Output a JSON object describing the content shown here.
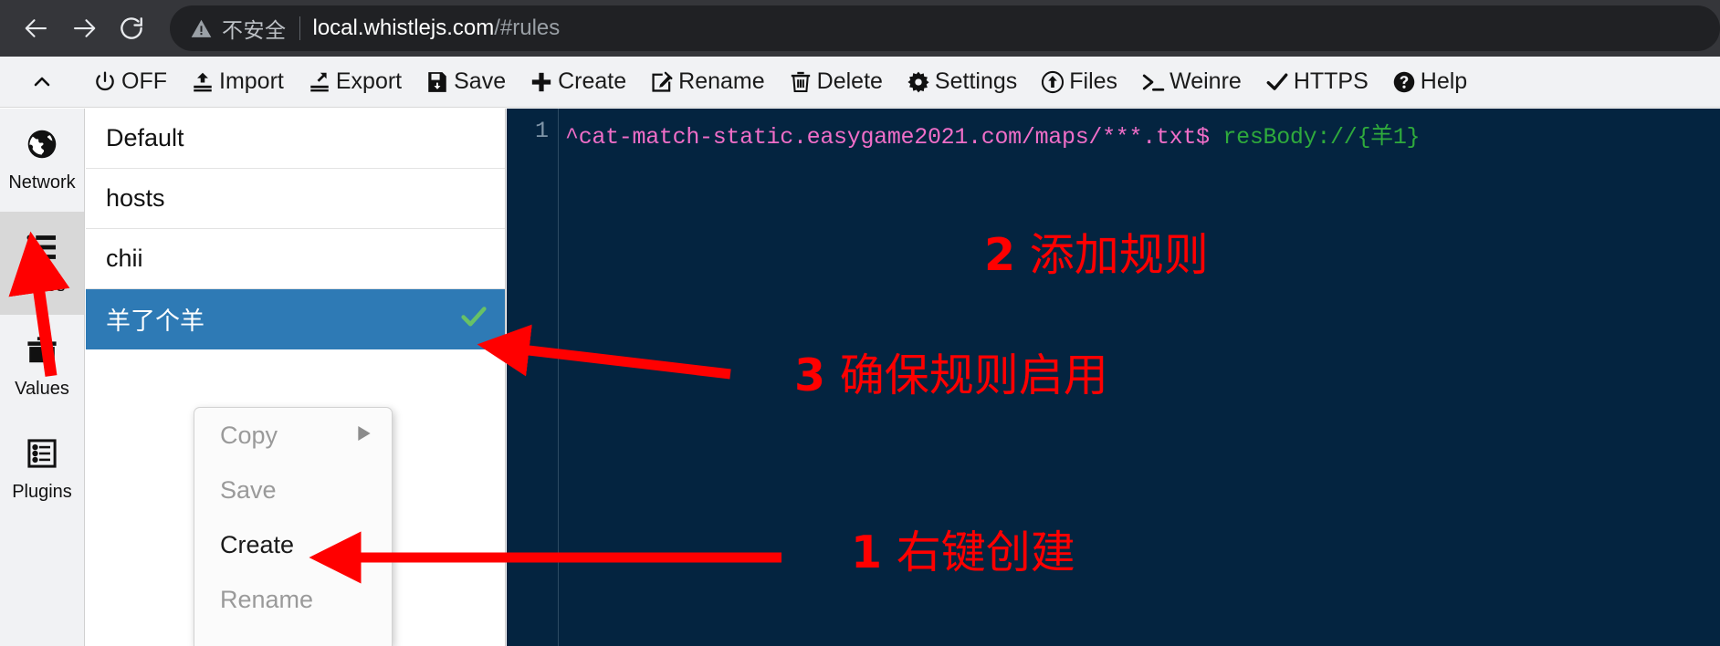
{
  "browser": {
    "back_icon": "arrow-left-icon",
    "forward_icon": "arrow-right-icon",
    "reload_icon": "reload-icon",
    "security_icon": "warning-triangle-icon",
    "security_label": "不安全",
    "url_host": "local.whistlejs.com",
    "url_path": "/#rules"
  },
  "toolbar": {
    "collapse_icon": "chevron-up-icon",
    "items": [
      {
        "label": "OFF",
        "icon": "power-icon"
      },
      {
        "label": "Import",
        "icon": "import-icon"
      },
      {
        "label": "Export",
        "icon": "export-icon"
      },
      {
        "label": "Save",
        "icon": "save-disk-icon"
      },
      {
        "label": "Create",
        "icon": "plus-icon"
      },
      {
        "label": "Rename",
        "icon": "pencil-square-icon"
      },
      {
        "label": "Delete",
        "icon": "trash-icon"
      },
      {
        "label": "Settings",
        "icon": "gear-icon"
      },
      {
        "label": "Files",
        "icon": "upload-circle-icon"
      },
      {
        "label": "Weinre",
        "icon": "terminal-prompt-icon"
      },
      {
        "label": "HTTPS",
        "icon": "check-icon"
      },
      {
        "label": "Help",
        "icon": "question-circle-icon"
      }
    ]
  },
  "rail": {
    "items": [
      {
        "label": "Network",
        "icon": "globe-icon",
        "active": false
      },
      {
        "label": "Rules",
        "icon": "list-icon",
        "active": true
      },
      {
        "label": "Values",
        "icon": "briefcase-icon",
        "active": false
      },
      {
        "label": "Plugins",
        "icon": "list-box-icon",
        "active": false
      }
    ]
  },
  "rules_list": {
    "rows": [
      {
        "name": "Default",
        "selected": false,
        "enabled": false
      },
      {
        "name": "hosts",
        "selected": false,
        "enabled": false
      },
      {
        "name": "chii",
        "selected": false,
        "enabled": false
      },
      {
        "name": "羊了个羊",
        "selected": true,
        "enabled": true,
        "check_icon": "check-icon"
      }
    ]
  },
  "context_menu": {
    "items": [
      {
        "label": "Copy",
        "enabled": false,
        "submenu_icon": "caret-right-icon",
        "has_submenu": true
      },
      {
        "label": "Save",
        "enabled": false,
        "has_submenu": false
      },
      {
        "label": "Create",
        "enabled": true,
        "has_submenu": false
      },
      {
        "label": "Rename",
        "enabled": false,
        "has_submenu": false
      }
    ]
  },
  "editor": {
    "line_number": "1",
    "code_pattern": "^cat-match-static.easygame2021.com/maps/***.txt$",
    "code_value": "resBody://{羊1}"
  },
  "annotations": [
    {
      "id": "anno-2",
      "number": "2",
      "text": "添加规则"
    },
    {
      "id": "anno-3",
      "number": "3",
      "text": "确保规则启用"
    },
    {
      "id": "anno-1",
      "number": "1",
      "text": "右键创建"
    }
  ],
  "colors": {
    "accent_selected": "#2e7ab5",
    "editor_bg": "#042440",
    "annotation_red": "#ff0000",
    "check_green": "#68c166",
    "code_pattern": "#f06ec8",
    "code_value": "#2faa3c"
  }
}
